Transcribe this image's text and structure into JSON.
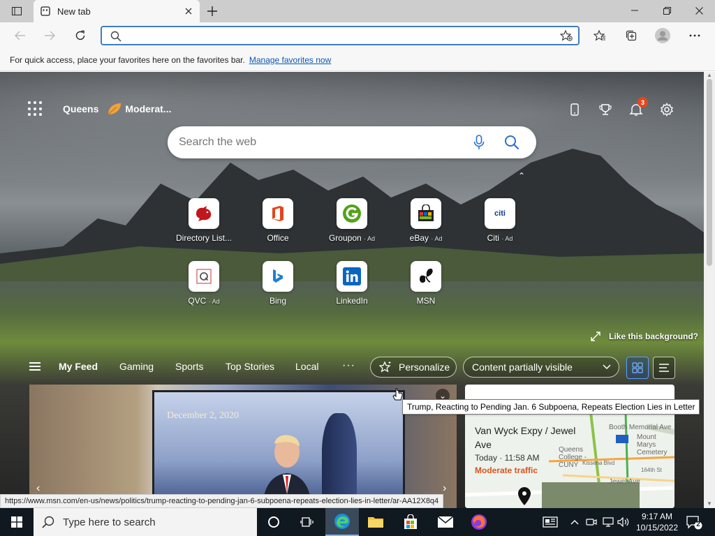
{
  "browser": {
    "tab_title": "New tab",
    "address_placeholder": "",
    "favorites_bar_text": "For quick access, place your favorites here on the favorites bar.",
    "manage_favorites_link": "Manage favorites now"
  },
  "newtab": {
    "location": "Queens",
    "weather": "Moderat...",
    "notifications_count": "3",
    "search_placeholder": "Search the web",
    "tiles": [
      {
        "label": "Directory List...",
        "ad": ""
      },
      {
        "label": "Office",
        "ad": ""
      },
      {
        "label": "Groupon",
        "ad": "· Ad"
      },
      {
        "label": "eBay",
        "ad": "· Ad"
      },
      {
        "label": "Citi",
        "ad": "· Ad"
      },
      {
        "label": "QVC",
        "ad": "· Ad"
      },
      {
        "label": "Bing",
        "ad": ""
      },
      {
        "label": "LinkedIn",
        "ad": ""
      },
      {
        "label": "MSN",
        "ad": ""
      }
    ],
    "citi_logo_text": "citi",
    "like_background": "Like this background?",
    "feed_tabs": [
      "My Feed",
      "Gaming",
      "Sports",
      "Top Stories",
      "Local"
    ],
    "more": "···",
    "personalize": "Personalize",
    "content_visibility": "Content partially visible",
    "news_date": "December 2, 2020",
    "tooltip": "Trump, Reacting to Pending Jan. 6 Subpoena, Repeats Election Lies in Letter",
    "traffic": {
      "place": "Van Wyck Expy / Jewel Ave",
      "time": "Today · 11:58 AM",
      "status": "Moderate traffic",
      "map_labels": [
        "Queens College - CUNY",
        "Booth Memorial Ave",
        "Mount Marys Cemetery",
        "Jewel Ave",
        "495",
        "164th St",
        "Kissena Blvd"
      ]
    }
  },
  "statusbar_url": "https://www.msn.com/en-us/news/politics/trump-reacting-to-pending-jan-6-subpoena-repeats-election-lies-in-letter/ar-AA12X8q4",
  "taskbar": {
    "search_placeholder": "Type here to search",
    "time": "9:17 AM",
    "date": "10/15/2022",
    "notification_count": "2"
  },
  "colors": {
    "accent": "#3b7ec8",
    "link": "#0a58b3",
    "badge": "#e0491d",
    "traffic_status": "#d9531e",
    "taskbar": "#101820"
  }
}
